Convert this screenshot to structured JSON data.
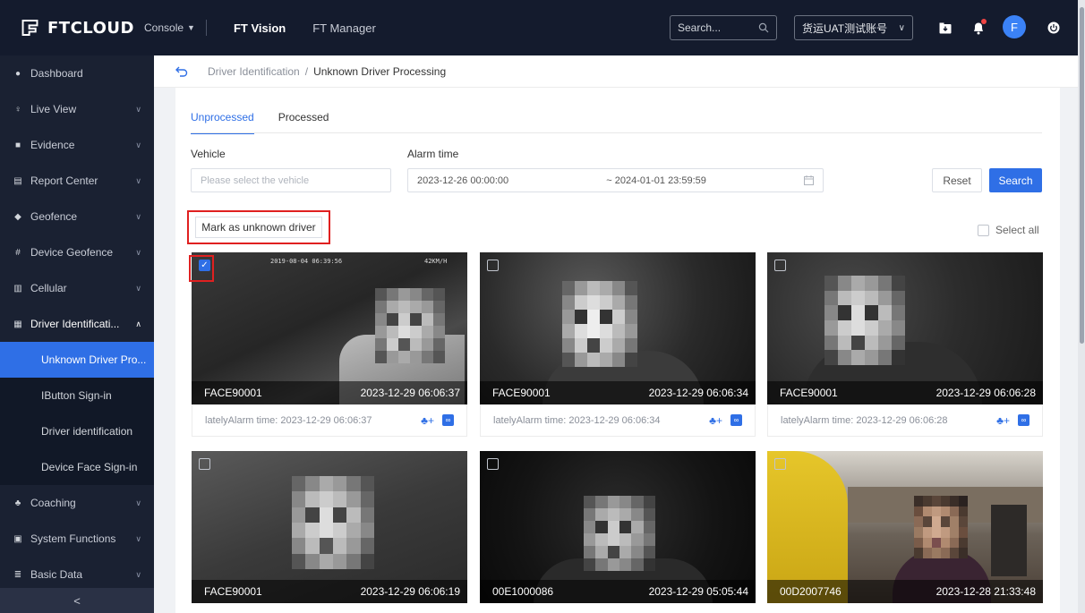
{
  "topbar": {
    "brand": "FTCLOUD",
    "console_label": "Console",
    "tabs": [
      "FT Vision",
      "FT Manager"
    ],
    "search_placeholder": "Search...",
    "account": "货运UAT测试账号",
    "avatar_letter": "F"
  },
  "sidebar": {
    "items": [
      {
        "label": "Dashboard",
        "icon": "dashboard-icon"
      },
      {
        "label": "Live View",
        "icon": "live-view-icon"
      },
      {
        "label": "Evidence",
        "icon": "evidence-icon"
      },
      {
        "label": "Report Center",
        "icon": "report-icon"
      },
      {
        "label": "Geofence",
        "icon": "geofence-icon"
      },
      {
        "label": "Device Geofence",
        "icon": "device-geofence-icon"
      },
      {
        "label": "Cellular",
        "icon": "cellular-icon"
      },
      {
        "label": "Driver Identificati...",
        "icon": "driver-id-icon"
      }
    ],
    "sub_items": [
      "Unknown Driver Pro...",
      "IButton Sign-in",
      "Driver identification",
      "Device Face Sign-in"
    ],
    "after_items": [
      {
        "label": "Coaching",
        "icon": "coaching-icon"
      },
      {
        "label": "System Functions",
        "icon": "system-icon"
      },
      {
        "label": "Basic Data",
        "icon": "basic-data-icon"
      }
    ],
    "collapse_glyph": "<"
  },
  "breadcrumb": {
    "parent": "Driver Identification",
    "separator": "/",
    "current": "Unknown Driver Processing"
  },
  "tabs": [
    "Unprocessed",
    "Processed"
  ],
  "filters": {
    "vehicle_label": "Vehicle",
    "vehicle_placeholder": "Please select the vehicle",
    "alarm_label": "Alarm time",
    "date_start": "2023-12-26 00:00:00",
    "date_end": "~ 2024-01-01 23:59:59",
    "reset": "Reset",
    "search": "Search"
  },
  "mark_button": "Mark as unknown driver",
  "select_all": "Select all",
  "osd": {
    "timestamp": "2019-08-04 06:39:56",
    "speed": "42KM/H"
  },
  "cards": [
    {
      "id": "FACE90001",
      "time": "2023-12-29 06:06:37",
      "lately": "latelyAlarm time: 2023-12-29 06:06:37",
      "checked": true
    },
    {
      "id": "FACE90001",
      "time": "2023-12-29 06:06:34",
      "lately": "latelyAlarm time: 2023-12-29 06:06:34",
      "checked": false
    },
    {
      "id": "FACE90001",
      "time": "2023-12-29 06:06:28",
      "lately": "latelyAlarm time: 2023-12-29 06:06:28",
      "checked": false
    },
    {
      "id": "FACE90001",
      "time": "2023-12-29 06:06:19",
      "checked": false
    },
    {
      "id": "00E1000086",
      "time": "2023-12-29 05:05:44",
      "checked": false
    },
    {
      "id": "00D2007746",
      "time": "2023-12-28 21:33:48",
      "checked": false
    }
  ],
  "colors": {
    "accent": "#2f6fe6",
    "highlight": "#e02020",
    "sidebar": "#1a2132",
    "topbar": "#141b2d"
  }
}
